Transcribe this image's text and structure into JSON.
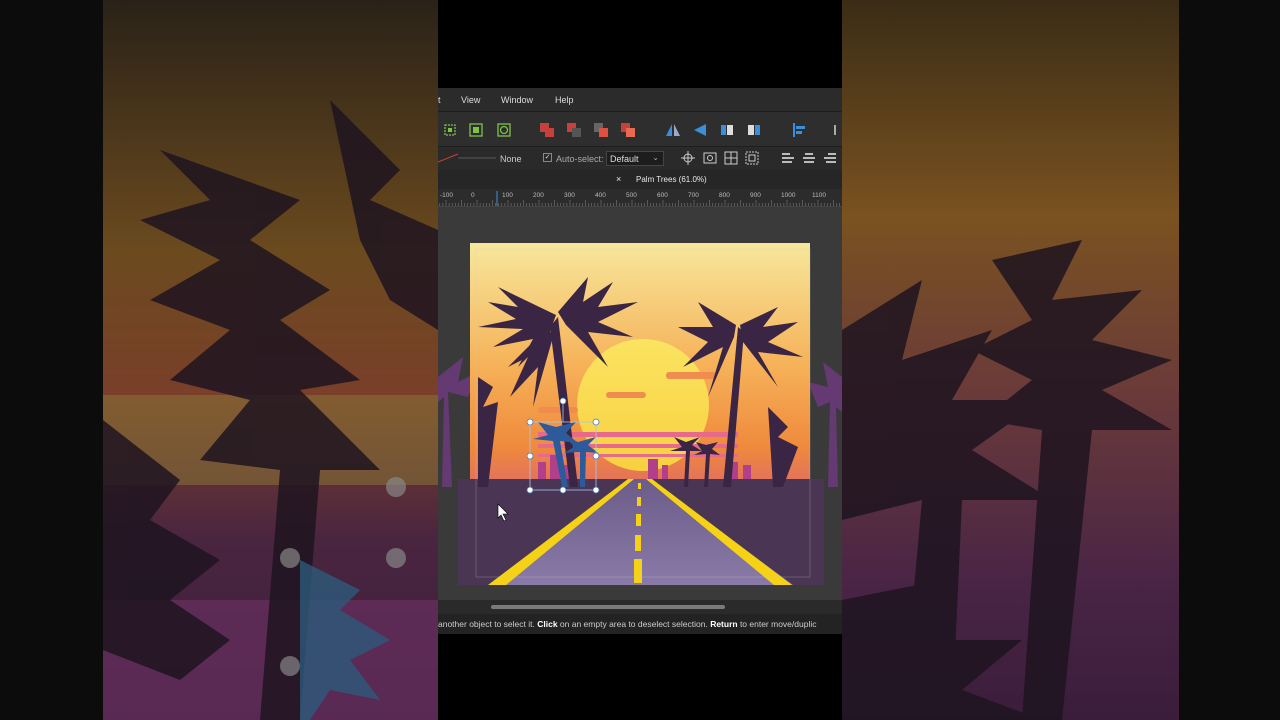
{
  "menu": {
    "insert_fragment": "t",
    "view": "View",
    "window": "Window",
    "help": "Help"
  },
  "context_toolbar": {
    "stroke_value": "None",
    "auto_select_label": "Auto-select:",
    "auto_select_value": "Default"
  },
  "document_tab": {
    "close_glyph": "×",
    "title": "Palm Trees (61.0%)"
  },
  "ruler": {
    "ticks": [
      "-100",
      "0",
      "100",
      "200",
      "300",
      "400",
      "500",
      "600",
      "700",
      "800",
      "900",
      "1000",
      "1100"
    ]
  },
  "status": {
    "part1": "another object to select it. ",
    "click_label": "Click",
    "part2": " on an empty area to deselect selection. ",
    "return_label": "Return",
    "part3": " to enter move/duplic"
  },
  "icons": {
    "toolbar": [
      "select-inside-icon",
      "select-group-icon",
      "select-clip-icon",
      "boolean-add-icon",
      "boolean-subtract-icon",
      "boolean-intersect-icon",
      "boolean-divide-icon",
      "flip-horizontal-icon",
      "flip-vertical-icon",
      "rotate-left-icon",
      "rotate-right-icon",
      "align-left-icon"
    ],
    "alignment": [
      "align-left-icon",
      "align-center-icon",
      "align-right-icon"
    ]
  },
  "colors": {
    "sky_top": "#f7e79c",
    "sky_mid": "#f49a3a",
    "sky_low": "#c23fa0",
    "sun": "#fbe461",
    "palm": "#3b2544",
    "road": "#7a6d9a",
    "ground": "#4a3654",
    "stripe": "#f5d216",
    "ui_dark": "#2b2b2b",
    "toolbar_red": "#c8403a",
    "toolbar_blue": "#3a8fd8"
  }
}
